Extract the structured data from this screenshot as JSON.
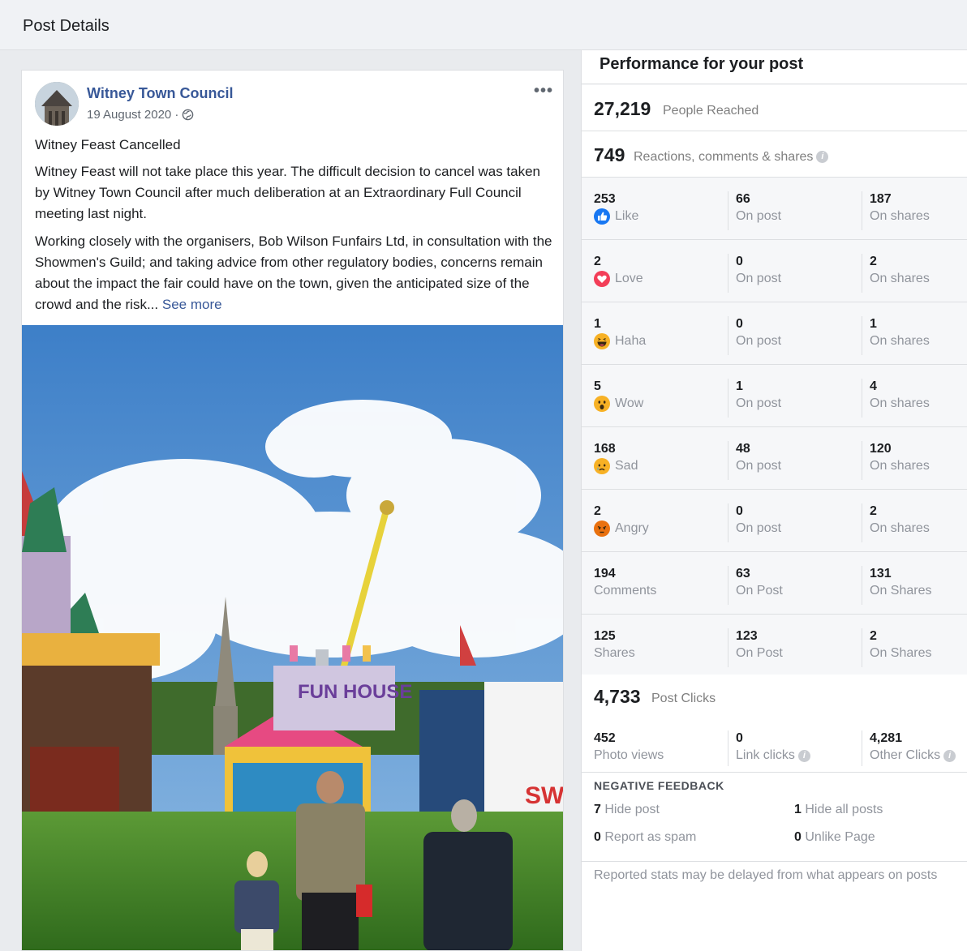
{
  "header": {
    "title": "Post Details"
  },
  "post": {
    "page_name": "Witney Town Council",
    "date": "19 August 2020 ·",
    "headline": "Witney Feast Cancelled",
    "paragraph1": "Witney Feast will not take place this year. The difficult decision to cancel was taken by Witney Town Council after much deliberation at an Extraordinary Full Council meeting last night.",
    "paragraph2": "Working closely with the organisers, Bob Wilson Funfairs Ltd, in consultation with the Showmen's Guild; and taking advice from other regulatory bodies, concerns remain about the impact the fair could have on the town, given the anticipated size of the crowd and the risk...",
    "see_more": "See more",
    "more_icon": "•••",
    "photo_text": {
      "sign1": "FUN HOUSE",
      "sign2": "SWEE"
    }
  },
  "performance": {
    "title": "Performance for your post",
    "people_reached": {
      "value": "27,219",
      "label": "People Reached"
    },
    "engagement": {
      "value": "749",
      "label": "Reactions, comments & shares",
      "info": "i"
    },
    "reactions": [
      {
        "total": "253",
        "label": "Like",
        "icon": "like-icon",
        "on_post": "66",
        "on_post_label": "On post",
        "on_shares": "187",
        "on_shares_label": "On shares"
      },
      {
        "total": "2",
        "label": "Love",
        "icon": "love-icon",
        "on_post": "0",
        "on_post_label": "On post",
        "on_shares": "2",
        "on_shares_label": "On shares"
      },
      {
        "total": "1",
        "label": "Haha",
        "icon": "haha-icon",
        "on_post": "0",
        "on_post_label": "On post",
        "on_shares": "1",
        "on_shares_label": "On shares"
      },
      {
        "total": "5",
        "label": "Wow",
        "icon": "wow-icon",
        "on_post": "1",
        "on_post_label": "On post",
        "on_shares": "4",
        "on_shares_label": "On shares"
      },
      {
        "total": "168",
        "label": "Sad",
        "icon": "sad-icon",
        "on_post": "48",
        "on_post_label": "On post",
        "on_shares": "120",
        "on_shares_label": "On shares"
      },
      {
        "total": "2",
        "label": "Angry",
        "icon": "angry-icon",
        "on_post": "0",
        "on_post_label": "On post",
        "on_shares": "2",
        "on_shares_label": "On shares"
      },
      {
        "total": "194",
        "label": "Comments",
        "icon": "",
        "on_post": "63",
        "on_post_label": "On Post",
        "on_shares": "131",
        "on_shares_label": "On Shares"
      },
      {
        "total": "125",
        "label": "Shares",
        "icon": "",
        "on_post": "123",
        "on_post_label": "On Post",
        "on_shares": "2",
        "on_shares_label": "On Shares"
      }
    ],
    "post_clicks": {
      "value": "4,733",
      "label": "Post Clicks",
      "photo_views": {
        "value": "452",
        "label": "Photo views"
      },
      "link_clicks": {
        "value": "0",
        "label": "Link clicks"
      },
      "other_clicks": {
        "value": "4,281",
        "label": "Other Clicks"
      }
    },
    "negative_feedback": {
      "title": "NEGATIVE FEEDBACK",
      "hide_post": {
        "value": "7",
        "label": "Hide post"
      },
      "hide_all_posts": {
        "value": "1",
        "label": "Hide all posts"
      },
      "report_spam": {
        "value": "0",
        "label": "Report as spam"
      },
      "unlike_page": {
        "value": "0",
        "label": "Unlike Page"
      }
    },
    "footnote": "Reported stats may be delayed from what appears on posts"
  },
  "colors": {
    "link": "#385898",
    "like": "#1877f2",
    "love": "#f33e58",
    "reaction_yellow": "#f7b125",
    "angry": "#e9710f"
  }
}
